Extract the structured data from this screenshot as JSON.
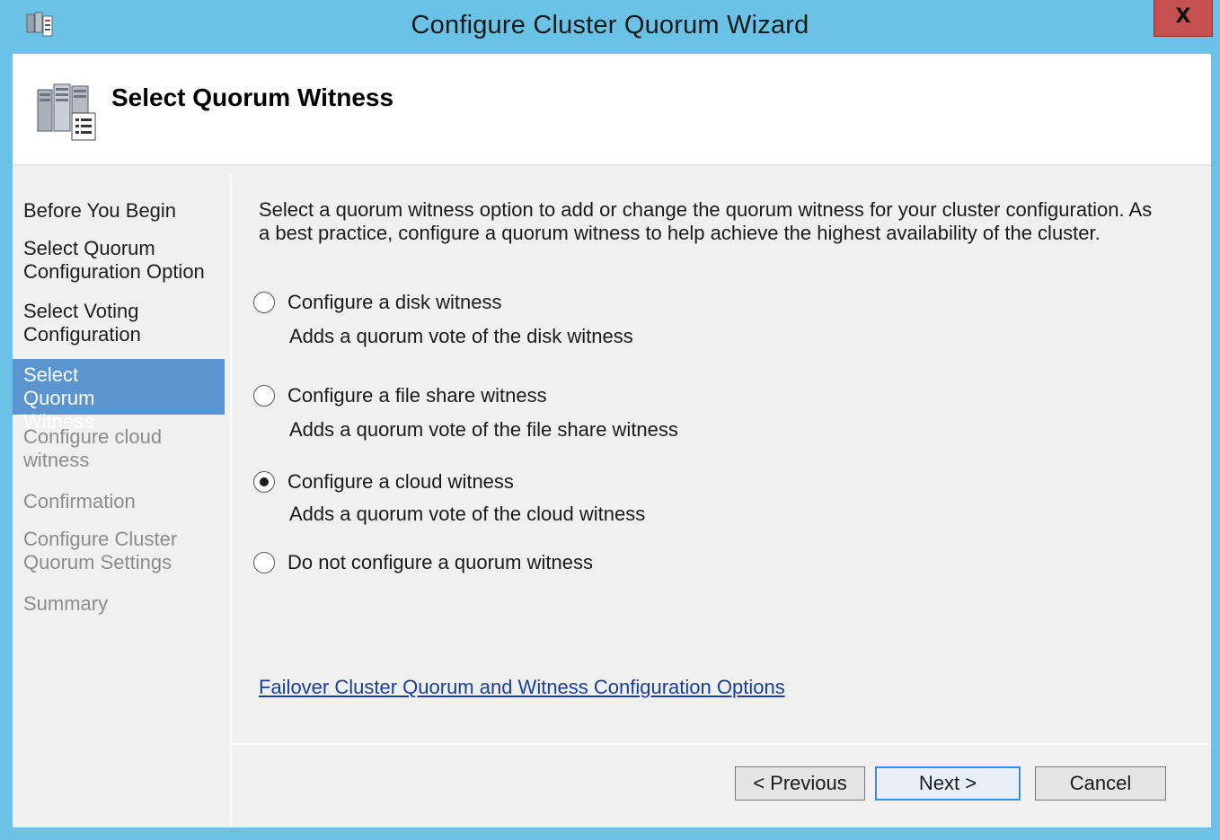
{
  "window": {
    "title": "Configure Cluster Quorum Wizard",
    "close_label": "X"
  },
  "header": {
    "title": "Select Quorum Witness"
  },
  "steps": [
    {
      "label": "Before You Begin",
      "state": "done"
    },
    {
      "label": "Select Quorum Configuration Option",
      "state": "done"
    },
    {
      "label": "Select Voting Configuration",
      "state": "done"
    },
    {
      "label": "Select Quorum Witness",
      "state": "active"
    },
    {
      "label": "Configure cloud witness",
      "state": "pending"
    },
    {
      "label": "Confirmation",
      "state": "pending"
    },
    {
      "label": "Configure Cluster Quorum Settings",
      "state": "pending"
    },
    {
      "label": "Summary",
      "state": "pending"
    }
  ],
  "main": {
    "intro": "Select a quorum witness option to add or change the quorum witness for your cluster configuration. As a best practice, configure a quorum witness to help achieve the highest availability of the cluster.",
    "options": [
      {
        "label": "Configure a disk witness",
        "description": "Adds a quorum vote of the disk witness",
        "selected": false
      },
      {
        "label": "Configure a file share witness",
        "description": "Adds a quorum vote of the file share witness",
        "selected": false
      },
      {
        "label": "Configure a cloud witness",
        "description": "Adds a quorum vote of the cloud witness",
        "selected": true
      },
      {
        "label": "Do not configure a quorum witness",
        "description": "",
        "selected": false
      }
    ],
    "help_link": "Failover Cluster Quorum and Witness Configuration Options"
  },
  "buttons": {
    "previous": "< Previous",
    "next": "Next >",
    "cancel": "Cancel"
  },
  "colors": {
    "titlebar": "#6ac3e6",
    "close": "#c75050",
    "active_step": "#5a95cf",
    "link": "#1a3d9e"
  }
}
